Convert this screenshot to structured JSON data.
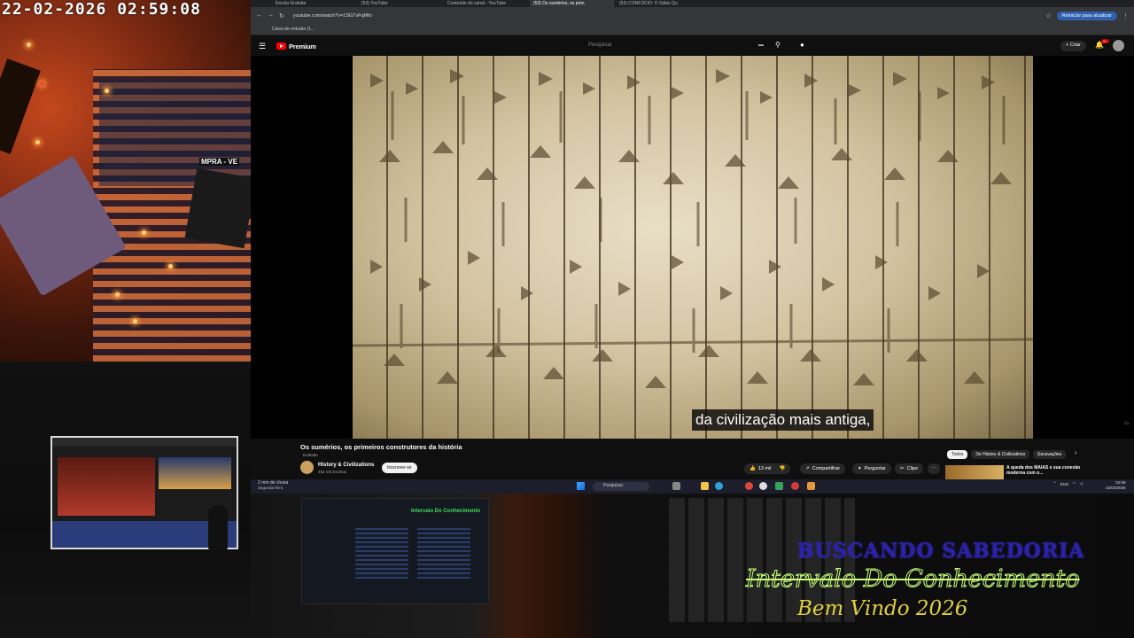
{
  "overlay": {
    "timestamp": "22-02-2026  02:59:08",
    "cam_sign": "MPRA - VE"
  },
  "browser": {
    "tabs": [
      "Escola Gratuita",
      "(53) YouTube",
      "Conteúdo do canal - YouTube",
      "(53) Os sumérios, os prim",
      "(53) CONFÚCIO: O Sábio Qu"
    ],
    "url": "youtube.com/watch?v=1SG7vFqMfo",
    "restart_label": "Reiniciar para atualizar",
    "bookmark": "Caixa de entrada (1..."
  },
  "youtube": {
    "logo_text": "Premium",
    "search_placeholder": "Pesquisar",
    "create_label": "Criar",
    "notif_count": "9+",
    "subtitle": "da civilização mais antiga,",
    "video_title": "Os sumérios, os primeiros construtores da história",
    "dubbed": "Dublado",
    "channel_name": "History & Civilizations",
    "channel_subs": "452 mil inscritos",
    "subscribe_label": "Inscrever-se",
    "likes": "13 mil",
    "share_label": "Compartilhar",
    "ask_label": "Perguntar",
    "clip_label": "Clipe",
    "chips": [
      "Todos",
      "De History & Civilizations",
      "Escavações"
    ],
    "rec_title": "A queda dos MAIAS e sua conexão moderna com o..."
  },
  "taskbar": {
    "weather_title": "2 mm de chuva",
    "weather_sub": "Segunda-feira",
    "search_label": "Pesquisar",
    "lang": "ENG",
    "time": "02:59",
    "date": "22/02/2026"
  },
  "studio": {
    "mini_title": "Intervalo Do Conhecimento",
    "busca": "BUSCANDO SABEDORIA",
    "intervalo": "Intervalo Do Conhecimento",
    "bemvindo": "Bem Vindo 2026"
  },
  "colors": {
    "yt_red": "#ff0000",
    "subscribe_bg": "#f1f1f1",
    "overlay_green": "#c8ff7a",
    "overlay_blue": "#2c22a8",
    "overlay_yellow": "#e2cf3f"
  }
}
